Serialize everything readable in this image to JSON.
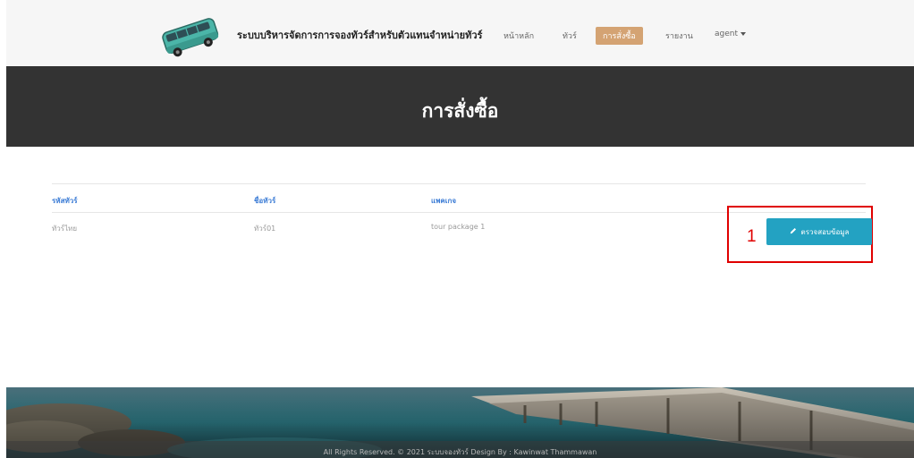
{
  "navbar": {
    "site_title": "ระบบบริหารจัดการการจองทัวร์สำหรับตัวแทนจำหน่ายทัวร์",
    "items": [
      {
        "label": "หน้าหลัก"
      },
      {
        "label": "ทัวร์"
      },
      {
        "label": "การสั่งซื้อ",
        "active": true
      },
      {
        "label": "รายงาน"
      },
      {
        "label": "agent"
      }
    ],
    "logo_icon": "bus-icon",
    "active_color": "#d4a373"
  },
  "header": {
    "title": "การสั่งซื้อ"
  },
  "table": {
    "columns": [
      "รหัสทัวร์",
      "ชื่อทัวร์",
      "แพคเกจ"
    ],
    "rows": [
      {
        "code": "ทัวร์ไทย",
        "name": "ทัวร์01",
        "package": "tour package 1"
      }
    ]
  },
  "action": {
    "button_label": "ตรวจสอบข้อมูล",
    "button_icon": "pencil-icon",
    "button_color": "#23a2c2",
    "annotation_number": "1",
    "annotation_color": "#e00000"
  },
  "footer": {
    "text": "All Rights Reserved. © 2021 ระบบจองทัวร์ Design By : Kawinwat Thammawan"
  }
}
